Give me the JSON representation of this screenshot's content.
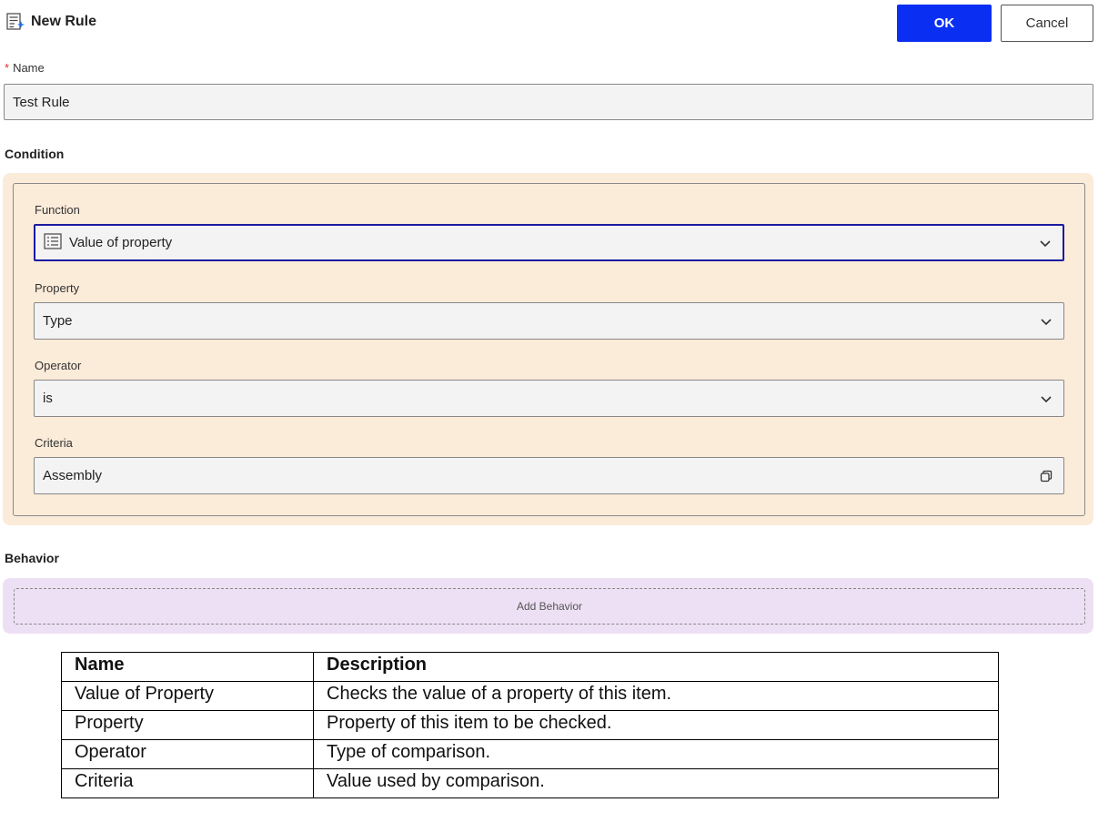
{
  "header": {
    "title": "New Rule",
    "title_icon": "rule-add-icon",
    "ok_label": "OK",
    "cancel_label": "Cancel"
  },
  "name_field": {
    "required_marker": "*",
    "label": "Name",
    "value": "Test Rule"
  },
  "condition": {
    "heading": "Condition",
    "function": {
      "label": "Function",
      "value": "Value of property",
      "icon": "list-icon"
    },
    "property": {
      "label": "Property",
      "value": "Type"
    },
    "operator": {
      "label": "Operator",
      "value": "is"
    },
    "criteria": {
      "label": "Criteria",
      "value": "Assembly",
      "icon": "open-dialog-icon"
    }
  },
  "behavior": {
    "heading": "Behavior",
    "add_label": "Add Behavior"
  },
  "doc_table": {
    "headers": [
      "Name",
      "Description"
    ],
    "rows": [
      [
        "Value of Property",
        "Checks the value of a property of this item."
      ],
      [
        "Property",
        "Property of this item to be checked."
      ],
      [
        "Operator",
        "Type of comparison."
      ],
      [
        "Criteria",
        "Value used by comparison."
      ]
    ]
  },
  "colors": {
    "ok_button": "#0b2ff2",
    "condition_bg": "#fbebd9",
    "behavior_bg": "#eee0f4",
    "focus_border": "#1a1aa0"
  }
}
